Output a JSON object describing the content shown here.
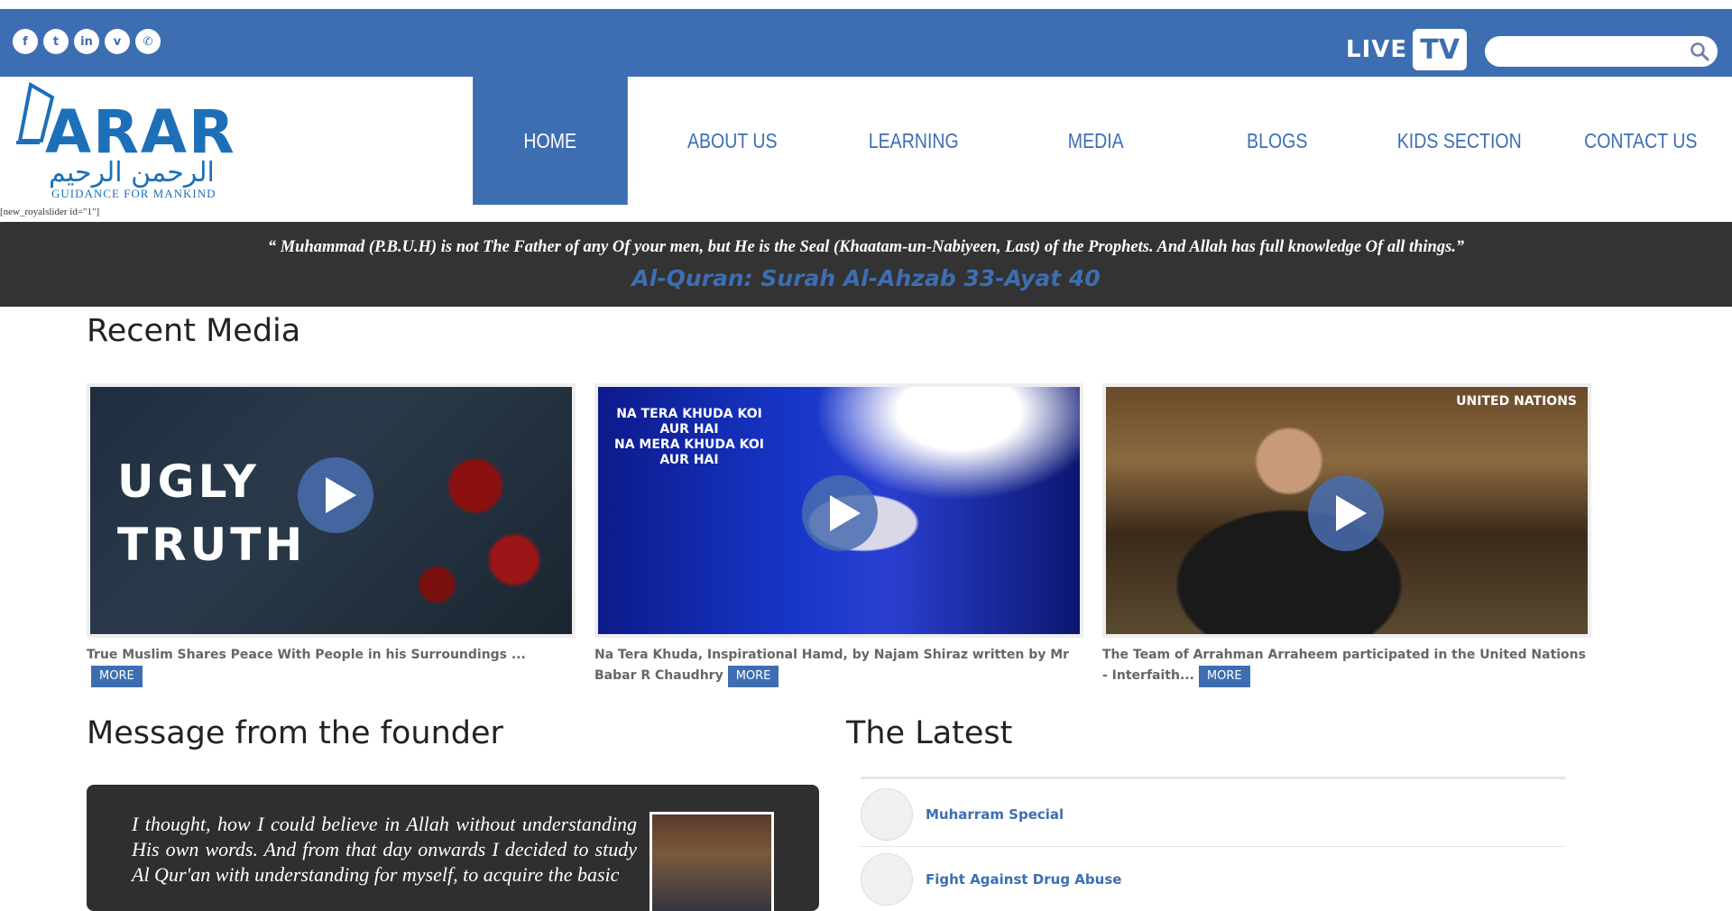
{
  "social": [
    "f",
    "t",
    "in",
    "v",
    "✆"
  ],
  "live_tv": {
    "live": "LIVE",
    "tv": "TV"
  },
  "search": {
    "placeholder": ""
  },
  "logo": {
    "word": "ARAR",
    "arabic": "الرحمن الرحيم",
    "tagline": "GUIDANCE FOR MANKIND"
  },
  "nav": [
    {
      "label": "HOME",
      "active": true
    },
    {
      "label": "ABOUT US"
    },
    {
      "label": "LEARNING"
    },
    {
      "label": "MEDIA"
    },
    {
      "label": "BLOGS"
    },
    {
      "label": "KIDS SECTION"
    },
    {
      "label": "CONTACT US"
    }
  ],
  "shortcode": "[new_royalslider id=\"1\"]",
  "quote": {
    "text": "“ Muhammad (P.B.U.H) is not The Father of any Of your men, but He is the Seal (Khaatam-un-Nabiyeen, Last) of the Prophets. And Allah has full knowledge Of all things.”",
    "reference": "Al-Quran: Surah Al-Ahzab 33-Ayat 40"
  },
  "recent_media": {
    "title": "Recent Media",
    "more_label": "MORE",
    "items": [
      {
        "caption": "True Muslim Shares Peace With People in his Surroundings ...",
        "overlay": [
          "UGLY",
          "TRUTH"
        ]
      },
      {
        "caption": "Na Tera Khuda, Inspirational Hamd, by Najam Shiraz written by Mr Babar R Chaudhry",
        "overlay": [
          "NA TERA KHUDA KOI",
          "AUR HAI",
          "NA MERA KHUDA KOI",
          "AUR HAI"
        ]
      },
      {
        "caption": "The Team of Arrahman Arraheem participated in the United Nations - Interfaith...",
        "overlay": [
          "UNITED NATIONS"
        ]
      }
    ]
  },
  "founder": {
    "title": "Message from the founder",
    "text": "I thought, how I could believe in Allah without understanding His own words. And from that day onwards I decided to study Al Qur'an with understanding for myself, to acquire the basic"
  },
  "latest": {
    "title": "The Latest",
    "items": [
      "Muharram Special",
      "Fight Against Drug Abuse"
    ]
  }
}
